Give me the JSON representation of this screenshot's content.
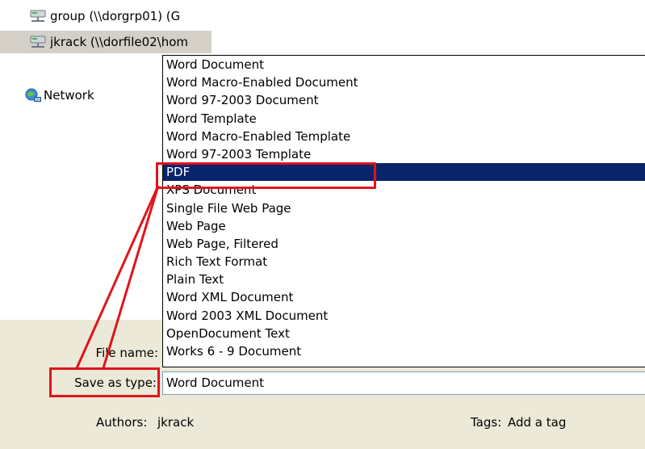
{
  "nav": {
    "items": [
      {
        "label": "group (\\\\dorgrp01) (G",
        "icon": "network-drive-icon"
      },
      {
        "label": "jkrack (\\\\dorfile02\\hom",
        "icon": "network-drive-icon"
      }
    ],
    "network_label": "Network",
    "network_icon": "network-globe-icon"
  },
  "save_as_type": {
    "options": [
      "Word Document",
      "Word Macro-Enabled Document",
      "Word 97-2003 Document",
      "Word Template",
      "Word Macro-Enabled Template",
      "Word 97-2003 Template",
      "PDF",
      "XPS Document",
      "Single File Web Page",
      "Web Page",
      "Web Page, Filtered",
      "Rich Text Format",
      "Plain Text",
      "Word XML Document",
      "Word 2003 XML Document",
      "OpenDocument Text",
      "Works 6 - 9 Document"
    ],
    "selected_option": "PDF",
    "current_value": "Word Document"
  },
  "labels": {
    "file_name": "File name:",
    "save_as_type": "Save as type:"
  },
  "meta": {
    "authors_label": "Authors:",
    "authors_value": "jkrack",
    "tags_label": "Tags:",
    "tags_value": "Add a tag"
  },
  "colors": {
    "highlight": "#e0141c",
    "selection": "#0a246a",
    "dialog_bg": "#ece9d8"
  }
}
